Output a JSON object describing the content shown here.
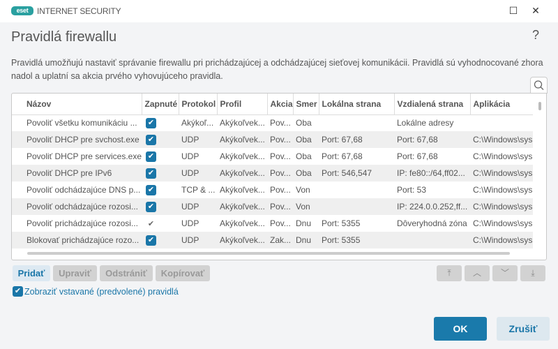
{
  "window": {
    "logo": "eset",
    "product": "INTERNET SECURITY",
    "minimize": "☐",
    "close": "✕"
  },
  "dialog": {
    "title": "Pravidlá firewallu",
    "help": "?",
    "description": "Pravidlá umožňujú nastaviť správanie firewallu pri prichádzajúcej a odchádzajúcej sieťovej komunikácii. Pravidlá sú vyhodnocované zhora nadol a uplatní sa akcia prvého vyhovujúceho pravidla."
  },
  "table": {
    "columns": [
      "Názov",
      "Zapnuté",
      "Protokol",
      "Profil",
      "Akcia",
      "Smer",
      "Lokálna strana",
      "Vzdialená strana",
      "Aplikácia"
    ],
    "rows": [
      {
        "name": "Povoliť všetku komunikáciu ...",
        "enabled": "box",
        "protocol": "Akýkoľ...",
        "profile": "Akýkoľvek...",
        "action": "Pov...",
        "direction": "Oba",
        "local": "",
        "remote": "Lokálne adresy",
        "app": ""
      },
      {
        "name": "Povoliť DHCP pre svchost.exe",
        "enabled": "box",
        "protocol": "UDP",
        "profile": "Akýkoľvek...",
        "action": "Pov...",
        "direction": "Oba",
        "local": "Port: 67,68",
        "remote": "Port: 67,68",
        "app": "C:\\Windows\\sys"
      },
      {
        "name": "Povoliť DHCP pre services.exe",
        "enabled": "box",
        "protocol": "UDP",
        "profile": "Akýkoľvek...",
        "action": "Pov...",
        "direction": "Oba",
        "local": "Port: 67,68",
        "remote": "Port: 67,68",
        "app": "C:\\Windows\\sys"
      },
      {
        "name": "Povoliť DHCP pre IPv6",
        "enabled": "box",
        "protocol": "UDP",
        "profile": "Akýkoľvek...",
        "action": "Pov...",
        "direction": "Oba",
        "local": "Port: 546,547",
        "remote": "IP: fe80::/64,ff02...",
        "app": "C:\\Windows\\sys"
      },
      {
        "name": "Povoliť odchádzajúce DNS p...",
        "enabled": "box",
        "protocol": "TCP & ...",
        "profile": "Akýkoľvek...",
        "action": "Pov...",
        "direction": "Von",
        "local": "",
        "remote": "Port: 53",
        "app": "C:\\Windows\\sys"
      },
      {
        "name": "Povoliť odchádzajúce rozosi...",
        "enabled": "box",
        "protocol": "UDP",
        "profile": "Akýkoľvek...",
        "action": "Pov...",
        "direction": "Von",
        "local": "",
        "remote": "IP: 224.0.0.252,ff...",
        "app": "C:\\Windows\\sys"
      },
      {
        "name": "Povoliť prichádzajúce rozosi...",
        "enabled": "plain",
        "protocol": "UDP",
        "profile": "Akýkoľvek...",
        "action": "Pov...",
        "direction": "Dnu",
        "local": "Port: 5355",
        "remote": "Dôveryhodná zóna",
        "app": "C:\\Windows\\sys"
      },
      {
        "name": "Blokovať prichádzajúce rozo...",
        "enabled": "box",
        "protocol": "UDP",
        "profile": "Akýkoľvek...",
        "action": "Zak...",
        "direction": "Dnu",
        "local": "Port: 5355",
        "remote": "",
        "app": "C:\\Windows\\sys"
      }
    ]
  },
  "buttons": {
    "add": "Pridať",
    "edit": "Upraviť",
    "delete": "Odstrániť",
    "copy": "Kopírovať",
    "top": "⤒",
    "up": "︿",
    "down": "﹀",
    "bottom": "⤓"
  },
  "show_builtin": "Zobraziť vstavané (predvolené) pravidlá",
  "ok": "OK",
  "cancel": "Zrušiť",
  "colors": {
    "accent": "#1a76a8",
    "brand": "#2aa0a0"
  }
}
